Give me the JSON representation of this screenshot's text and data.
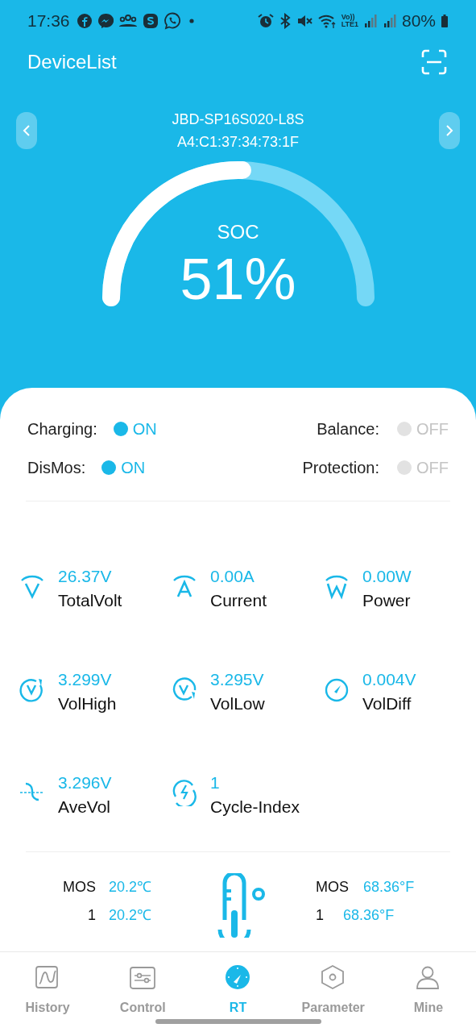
{
  "status_bar": {
    "time": "17:36",
    "volte": [
      "Vo))",
      "LTE1"
    ],
    "battery": "80%"
  },
  "header": {
    "title": "DeviceList"
  },
  "device": {
    "name": "JBD-SP16S020-L8S",
    "address": "A4:C1:37:34:73:1F"
  },
  "gauge": {
    "label": "SOC",
    "reading": "51%"
  },
  "states": [
    {
      "label": "Charging:",
      "value": "ON",
      "on": true
    },
    {
      "label": "Balance:",
      "value": "OFF",
      "on": false
    },
    {
      "label": "DisMos:",
      "value": "ON",
      "on": true
    },
    {
      "label": "Protection:",
      "value": "OFF",
      "on": false
    }
  ],
  "metrics": [
    {
      "kind": "volt",
      "value": "26.37V",
      "label": "TotalVolt"
    },
    {
      "kind": "amp",
      "value": "0.00A",
      "label": "Current"
    },
    {
      "kind": "watt",
      "value": "0.00W",
      "label": "Power"
    },
    {
      "kind": "high",
      "value": "3.299V",
      "label": "VolHigh"
    },
    {
      "kind": "low",
      "value": "3.295V",
      "label": "VolLow"
    },
    {
      "kind": "diff",
      "value": "0.004V",
      "label": "VolDiff"
    },
    {
      "kind": "avg",
      "value": "3.296V",
      "label": "AveVol"
    },
    {
      "kind": "cycle",
      "value": "1",
      "label": "Cycle-Index"
    }
  ],
  "temperatures": {
    "celsius": [
      {
        "sensor": "MOS",
        "value": "20.2℃"
      },
      {
        "sensor": "1",
        "value": "20.2℃"
      }
    ],
    "fahrenheit": [
      {
        "sensor": "MOS",
        "value": "68.36°F"
      },
      {
        "sensor": "1",
        "value": "68.36°F"
      }
    ]
  },
  "nav": [
    {
      "kind": "history",
      "label": "History",
      "selected": false
    },
    {
      "kind": "control",
      "label": "Control",
      "selected": false
    },
    {
      "kind": "rt",
      "label": "RT",
      "selected": true
    },
    {
      "kind": "parameter",
      "label": "Parameter",
      "selected": false
    },
    {
      "kind": "mine",
      "label": "Mine",
      "selected": false
    }
  ]
}
